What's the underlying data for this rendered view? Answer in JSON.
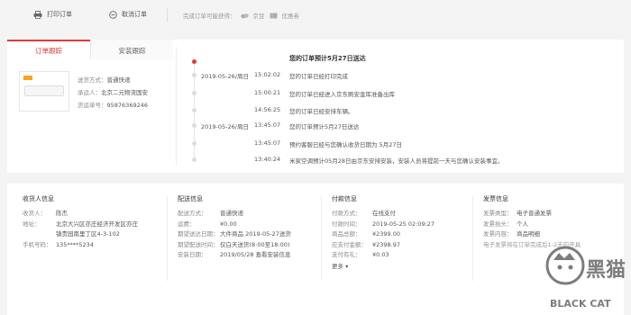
{
  "toolbar": {
    "print_label": "打印订单",
    "cancel_label": "取消订单",
    "reward_note": "完成订单可能获得：",
    "reward_beans": "京豆",
    "reward_coupon": "优惠券"
  },
  "tabs": {
    "tracking": "订单跟踪",
    "install": "安装跟踪"
  },
  "shipping": {
    "method_k": "送货方式：",
    "method_v": "普通快递",
    "carrier_k": "承运人：",
    "carrier_v": "北京二元物流国安",
    "tracking_k": "货运单号：",
    "tracking_v": "95876369246"
  },
  "tracking_header": "您的订单预计5月27日送达",
  "timeline": [
    {
      "date": "2019-05-26/周日",
      "time": "15:02:02",
      "msg": "您的订单已经打印完成"
    },
    {
      "date": "",
      "time": "15:00:21",
      "msg": "您的订单已经进入京东刷安金库准备出库"
    },
    {
      "date": "",
      "time": "14:56:25",
      "msg": "您的订单已经安排车辆。"
    },
    {
      "date": "2019-05-26/周日",
      "time": "13:45:07",
      "msg": "您的订单预计5月27日送达"
    },
    {
      "date": "",
      "time": "13:45:07",
      "msg": "预约客服已经与您确认收货日期为 5月27日"
    },
    {
      "date": "",
      "time": "13:40:24",
      "msg": "米家空调预计05月28日由京东安排安装，安装人员将提前一天与您确认安装事宜。"
    }
  ],
  "receiver": {
    "title": "收货人信息",
    "name_k": "收货人：",
    "name_v": "陈杰",
    "addr_k": "地址：",
    "addr_v1": "北京大兴区亦庄经济开发区亦庄",
    "addr_v2": "镇贵园南里丁区4-3-102",
    "phone_k": "手机号码：",
    "phone_v": "135****5234"
  },
  "delivery": {
    "title": "配送信息",
    "method_k": "配送方式：",
    "method_v": "普通快递",
    "fee_k": "运费：",
    "fee_v": "¥0.00",
    "date1_k": "期望送达日期：",
    "date1_v": "大件商品 2019-05-27送货",
    "time_k": "期望配送时间：",
    "time_v": "仅白天送货(8:00至18:00)",
    "install_k": "安装日期：",
    "install_v": "2019/05/28  查看安装信息"
  },
  "payment": {
    "title": "付款信息",
    "method_k": "付款方式：",
    "method_v": "在线支付",
    "time_k": "付款时间：",
    "time_v": "2019-05-25 02:09:27",
    "goods_k": "商品总额：",
    "goods_v": "¥2399.00",
    "due_k": "应支付金额：",
    "due_v": "¥2398.97",
    "promo_k": "支付有礼：",
    "promo_v": "¥0.03",
    "more": "更多 ▾"
  },
  "invoice": {
    "title": "发票信息",
    "type_k": "发票类型：",
    "type_v": "电子普通发票",
    "head_k": "发票抬头：",
    "head_v": "个人",
    "content_k": "发票内容：",
    "content_v": "商品明细",
    "note": "电子发票将在订单完成后1-2天内开具"
  },
  "watermark": {
    "text_cn": "黑猫",
    "text_en": "BLACK CAT"
  },
  "colors": {
    "accent": "#e4393c",
    "panel": "#ffffff",
    "bg": "#f4f4f4"
  }
}
